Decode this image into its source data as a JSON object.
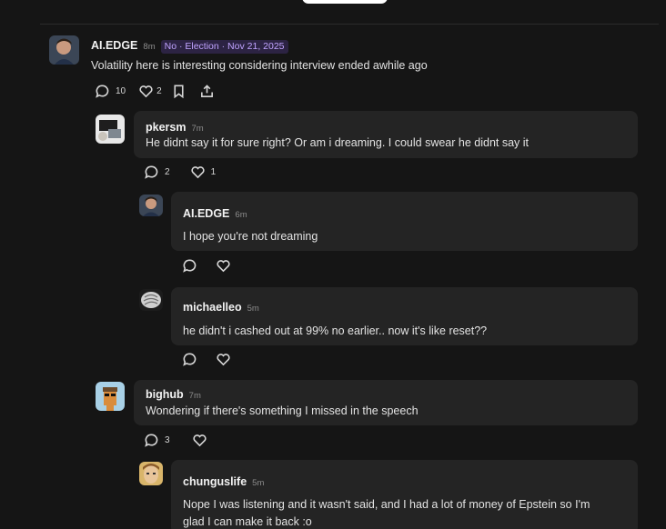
{
  "comment": {
    "username": "AI.EDGE",
    "time": "8m",
    "tag": "No · Election · Nov 21, 2025",
    "text": "Volatility here is interesting considering interview ended awhile ago",
    "reply_count": "10",
    "like_count": "2"
  },
  "reply1": {
    "username": "pkersm",
    "time": "7m",
    "text": "He didnt say it for sure right? Or am i dreaming. I could swear he didnt say it",
    "reply_count": "2",
    "like_count": "1"
  },
  "reply1a": {
    "username": "AI.EDGE",
    "time": "6m",
    "text": "I hope you're not dreaming"
  },
  "reply1b": {
    "username": "michaelleo",
    "time": "5m",
    "text": "he didn't i cashed out at 99% no earlier.. now it's like reset??"
  },
  "reply2": {
    "username": "bighub",
    "time": "7m",
    "text": "Wondering if there's something I missed in the speech",
    "reply_count": "3"
  },
  "reply2a": {
    "username": "chunguslife",
    "time": "5m",
    "text_line1": "Nope I was listening and it wasn't said, and I had a lot of money of Epstein so I'm",
    "text_line2": "glad I can make it back :o"
  },
  "icons": [
    "comment-icon",
    "heart-icon",
    "bookmark-icon",
    "share-icon"
  ],
  "colors": {
    "background": "#151515",
    "bubble": "#242424",
    "tag_text": "#c0a3ff",
    "tag_bg": "#2c2343"
  }
}
